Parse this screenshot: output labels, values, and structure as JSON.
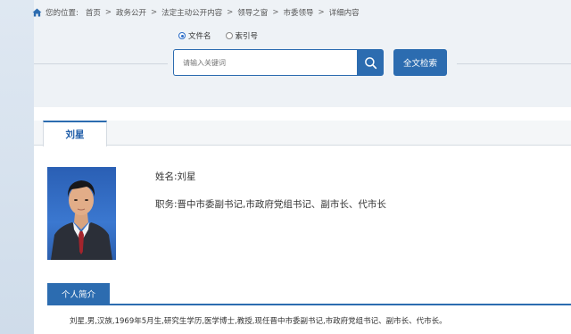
{
  "breadcrumb": {
    "prefix": "您的位置:",
    "items": [
      "首页",
      "政务公开",
      "法定主动公开内容",
      "领导之窗",
      "市委领导",
      "详细内容"
    ],
    "separator": ">"
  },
  "search": {
    "options": [
      {
        "label": "文件名",
        "selected": true
      },
      {
        "label": "索引号",
        "selected": false
      }
    ],
    "placeholder": "请输入关键词",
    "full_text_button": "全文检索"
  },
  "profile": {
    "tab_label": "刘星",
    "name_line": "姓名:刘星",
    "position_line": "职务:晋中市委副书记,市政府党组书记、副市长、代市长",
    "section_label": "个人简介",
    "bio": "刘星,男,汉族,1969年5月生,研究生学历,医学博士,教授,现任晋中市委副书记,市政府党组书记、副市长、代市长。"
  },
  "colors": {
    "accent": "#2c6cb0",
    "page_bg": "#eef2f6",
    "panel_bg": "#ffffff"
  },
  "icons": [
    "home-icon",
    "search-icon"
  ]
}
